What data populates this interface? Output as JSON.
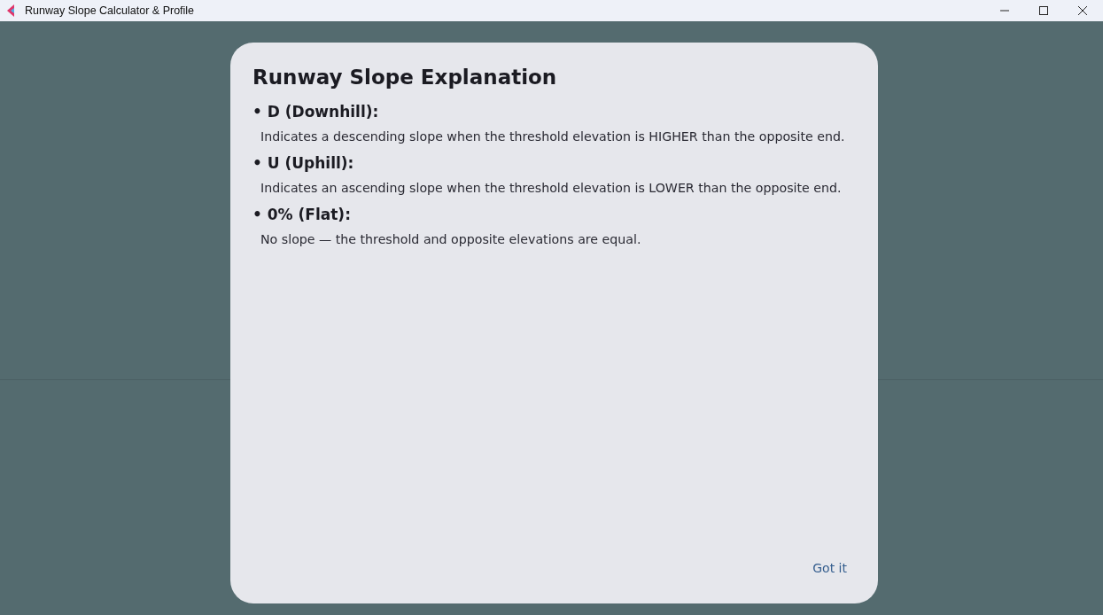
{
  "window": {
    "title": "Runway Slope Calculator & Profile"
  },
  "dialog": {
    "title": "Runway Slope Explanation",
    "items": [
      {
        "term": "• D (Downhill):",
        "description": "Indicates a descending slope when the threshold elevation is HIGHER than the opposite end."
      },
      {
        "term": "• U (Uphill):",
        "description": "Indicates an ascending slope when the threshold elevation is LOWER than the opposite end."
      },
      {
        "term": "• 0% (Flat):",
        "description": "No slope — the threshold and opposite elevations are equal."
      }
    ],
    "button": "Got it"
  }
}
